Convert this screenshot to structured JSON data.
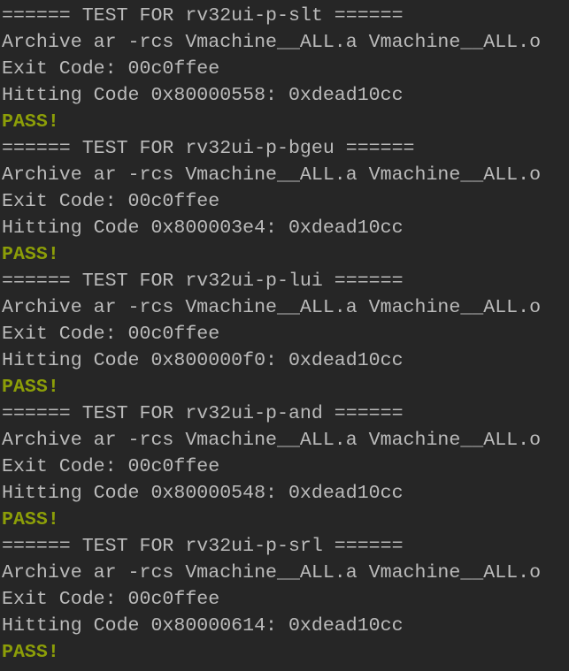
{
  "colors": {
    "background": "#262626",
    "text": "#bbbbbb",
    "pass": "#8c9e08"
  },
  "tests": [
    {
      "header": "====== TEST FOR rv32ui-p-slt ======",
      "archive": "Archive ar -rcs Vmachine__ALL.a Vmachine__ALL.o",
      "exit": "Exit Code: 00c0ffee",
      "hitting": "Hitting Code 0x80000558: 0xdead10cc",
      "result": "PASS!"
    },
    {
      "header": "====== TEST FOR rv32ui-p-bgeu ======",
      "archive": "Archive ar -rcs Vmachine__ALL.a Vmachine__ALL.o",
      "exit": "Exit Code: 00c0ffee",
      "hitting": "Hitting Code 0x800003e4: 0xdead10cc",
      "result": "PASS!"
    },
    {
      "header": "====== TEST FOR rv32ui-p-lui ======",
      "archive": "Archive ar -rcs Vmachine__ALL.a Vmachine__ALL.o",
      "exit": "Exit Code: 00c0ffee",
      "hitting": "Hitting Code 0x800000f0: 0xdead10cc",
      "result": "PASS!"
    },
    {
      "header": "====== TEST FOR rv32ui-p-and ======",
      "archive": "Archive ar -rcs Vmachine__ALL.a Vmachine__ALL.o",
      "exit": "Exit Code: 00c0ffee",
      "hitting": "Hitting Code 0x80000548: 0xdead10cc",
      "result": "PASS!"
    },
    {
      "header": "====== TEST FOR rv32ui-p-srl ======",
      "archive": "Archive ar -rcs Vmachine__ALL.a Vmachine__ALL.o",
      "exit": "Exit Code: 00c0ffee",
      "hitting": "Hitting Code 0x80000614: 0xdead10cc",
      "result": "PASS!"
    }
  ]
}
